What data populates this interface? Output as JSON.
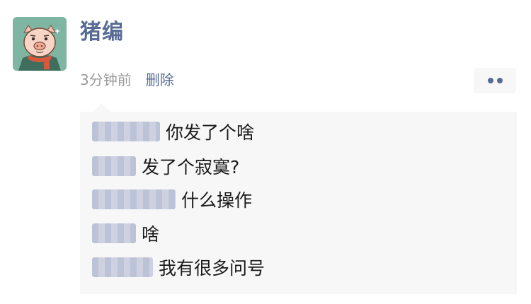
{
  "post": {
    "author": "猪编",
    "time": "3分钟前",
    "delete_label": "删除",
    "avatar_icon": "pig-avatar-icon",
    "more_icon": "more-dots-icon"
  },
  "comments": [
    {
      "text": "你发了个啥"
    },
    {
      "text": "发了个寂寞?"
    },
    {
      "text": "什么操作"
    },
    {
      "text": "啥"
    },
    {
      "text": "我有很多问号"
    }
  ],
  "colors": {
    "link": "#576b95",
    "meta": "#9a9a9a",
    "comment_bg": "#f7f7f7",
    "avatar_bg": "#7fb5a3"
  }
}
